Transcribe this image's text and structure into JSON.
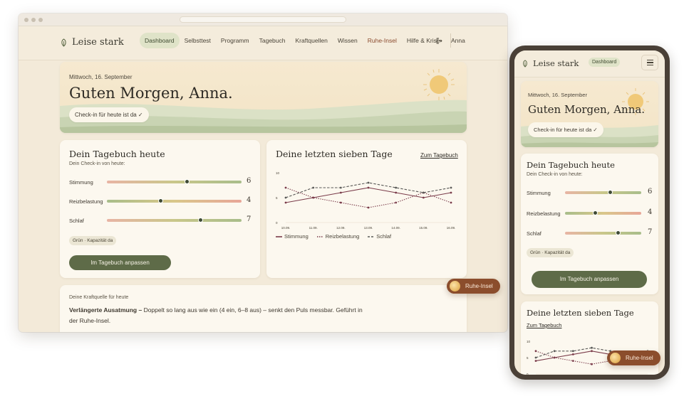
{
  "brand": {
    "name": "Leise stark"
  },
  "nav": {
    "items": [
      {
        "label": "Dashboard"
      },
      {
        "label": "Selbsttest"
      },
      {
        "label": "Programm"
      },
      {
        "label": "Tagebuch"
      },
      {
        "label": "Kraftquellen"
      },
      {
        "label": "Wissen"
      },
      {
        "label": "Ruhe-Insel"
      },
      {
        "label": "Hilfe & Krise"
      }
    ],
    "user_name": "Anna"
  },
  "hero": {
    "date": "Mittwoch, 16. September",
    "greeting": "Guten Morgen, Anna.",
    "checkin_label": "Check-in für heute ist da ✓"
  },
  "journal": {
    "title": "Dein Tagebuch heute",
    "subtitle": "Dein Check-in von heute:",
    "rows": [
      {
        "label": "Stimmung",
        "value": "6",
        "level": 0.6
      },
      {
        "label": "Reizbelastung",
        "value": "4",
        "level": 0.4
      },
      {
        "label": "Schlaf",
        "value": "7",
        "level": 0.7
      }
    ],
    "status_tag": "Grün · Kapazität da",
    "button_label": "Im Tagebuch anpassen"
  },
  "week": {
    "title": "Deine letzten sieben Tage",
    "link_label": "Zum Tagebuch"
  },
  "chart_data": {
    "type": "line",
    "categories": [
      "10.09.",
      "11.09.",
      "12.09.",
      "13.09.",
      "14.09.",
      "15.09.",
      "16.09."
    ],
    "ylim": [
      0,
      10
    ],
    "yticks": [
      "0",
      "5",
      "10"
    ],
    "series": [
      {
        "name": "Stimmung",
        "color": "#7a3b4a",
        "style": "solid",
        "values": [
          4,
          5,
          6,
          7,
          6,
          5,
          6
        ]
      },
      {
        "name": "Reizbelastung",
        "color": "#7a3b4a",
        "style": "dotted",
        "values": [
          7,
          5,
          4,
          3,
          4,
          6,
          4
        ]
      },
      {
        "name": "Schlaf",
        "color": "#5a5a58",
        "style": "dashed",
        "values": [
          5,
          7,
          7,
          8,
          7,
          6,
          7
        ]
      }
    ],
    "legend_position": "bottom-left"
  },
  "kraftquelle": {
    "label": "Deine Kraftquelle für heute",
    "title": "Verlängerte Ausatmung –",
    "text_line1": "Doppelt so lang aus wie ein (4 ein, 6–8 aus) – senkt den Puls messbar. Geführt in",
    "text_line2": "der Ruhe-Insel."
  },
  "ruhe_button": {
    "label": "Ruhe-Insel"
  },
  "colors": {
    "accent_green": "#5e6b48",
    "ruhe_brown": "#8b4d2c",
    "background": "#f3ead9",
    "sun": "#f0c978"
  },
  "icons": {
    "brand": "leaf-icon",
    "logout": "logout-icon",
    "menu": "hamburger-menu-icon",
    "sun": "sun-icon"
  }
}
